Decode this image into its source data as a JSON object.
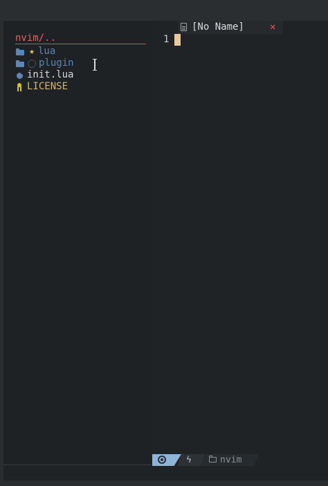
{
  "explorer": {
    "root_label": "nvim/..",
    "items": [
      {
        "label": "lua",
        "color": "#5b87b5",
        "icons": [
          "folder-icon",
          "star-icon"
        ]
      },
      {
        "label": "plugin",
        "color": "#5b87b5",
        "icons": [
          "folder-icon",
          "loading-ring-icon"
        ]
      },
      {
        "label": "init.lua",
        "color": "#d7dae0",
        "icons": [
          "lua-file-icon"
        ]
      },
      {
        "label": "LICENSE",
        "color": "#d7b46a",
        "icons": [
          "license-icon"
        ]
      }
    ]
  },
  "editor": {
    "tab": {
      "label": "[No Name]",
      "close_label": "✕"
    },
    "line_number": "1"
  },
  "statusline": {
    "mode_icon": "vim-mode-icon",
    "lsp_icon": "bolt-icon",
    "cwd_label": "nvim"
  },
  "colors": {
    "background": "#1f2326",
    "accent_red": "#d9646a",
    "folder_blue": "#5b87b5",
    "cursor": "#e6c9a0",
    "mode_blue": "#8fb3d6"
  }
}
